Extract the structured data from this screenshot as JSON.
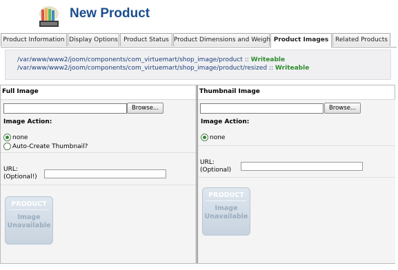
{
  "header": {
    "title": "New Product",
    "logo_icon": "product-box-icon"
  },
  "tabs": [
    {
      "label": "Product Information",
      "active": false
    },
    {
      "label": "Display Options",
      "active": false
    },
    {
      "label": "Product Status",
      "active": false
    },
    {
      "label": "Product Dimensions and Weight",
      "active": false
    },
    {
      "label": "Product Images",
      "active": true
    },
    {
      "label": "Related Products",
      "active": false
    }
  ],
  "paths": [
    {
      "path": "/var/www/www2/joom/components/com_virtuemart/shop_image/product",
      "sep": " :: ",
      "status": "Writeable"
    },
    {
      "path": "/var/www/www2/joom/components/com_virtuemart/shop_image/product/resized",
      "sep": " :: ",
      "status": "Writeable"
    }
  ],
  "full_image": {
    "heading": "Full Image",
    "browse_label": "Browse...",
    "action_label": "Image Action:",
    "options": [
      {
        "label": "none",
        "checked": true
      },
      {
        "label": "Auto-Create Thumbnail?",
        "checked": false
      }
    ],
    "url_label_line1": "URL:",
    "url_label_line2": "(Optional!)",
    "url_value": "",
    "placeholder_top": "PRODUCT",
    "placeholder_line1": "Image",
    "placeholder_line2": "Unavailable"
  },
  "thumbnail_image": {
    "heading": "Thumbnail Image",
    "browse_label": "Browse...",
    "action_label": "Image Action:",
    "options": [
      {
        "label": "none",
        "checked": true
      }
    ],
    "url_label_line1": "URL:",
    "url_label_line2": "(Optional)",
    "url_value": "",
    "placeholder_top": "PRODUCT",
    "placeholder_line1": "Image",
    "placeholder_line2": "Unavailable"
  },
  "colors": {
    "title": "#1a4d8f",
    "path_text": "#1c3f7a",
    "writeable": "#2e8b2e"
  }
}
